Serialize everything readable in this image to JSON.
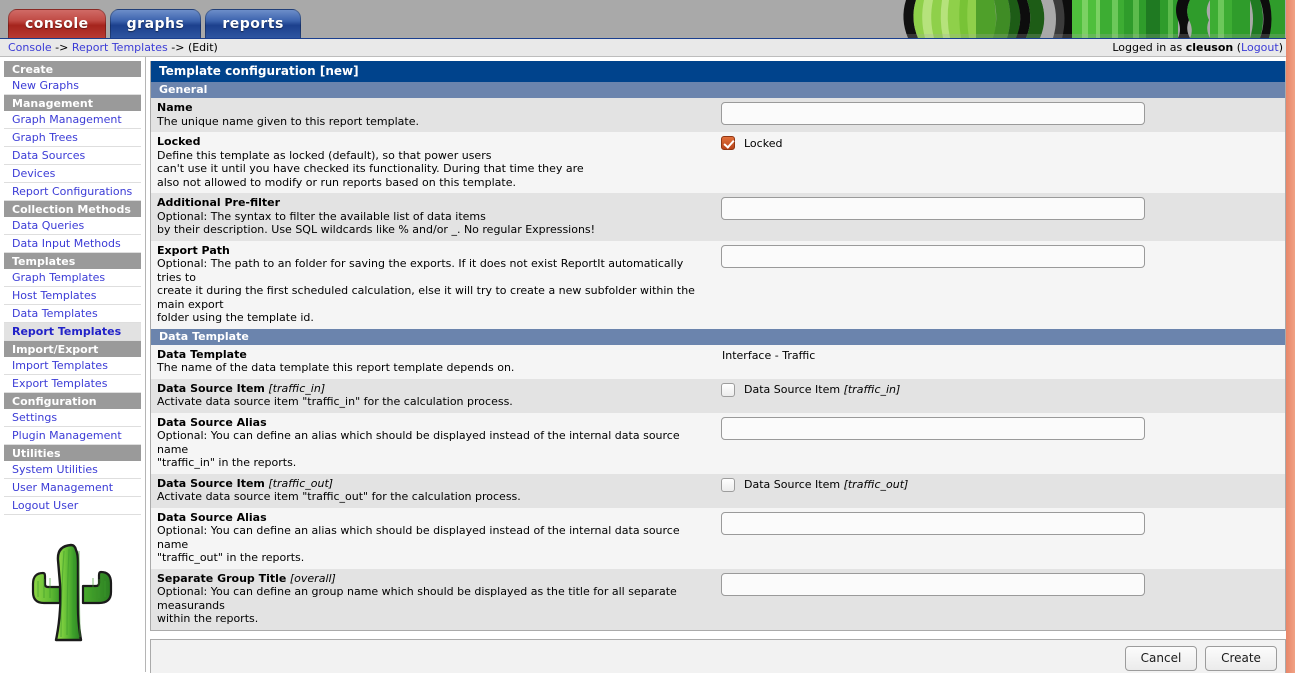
{
  "app": {
    "tabs": [
      {
        "label": "console",
        "style": "red"
      },
      {
        "label": "graphs",
        "style": "blue"
      },
      {
        "label": "reports",
        "style": "blue"
      }
    ],
    "breadcrumb": "Console -> Report Templates -> (Edit)",
    "breadcrumb_parts": {
      "console": "Console",
      "sep1": " -> ",
      "report_templates": "Report Templates",
      "sep2": " -> ",
      "current": "(Edit)"
    },
    "login": {
      "prefix": "Logged in as ",
      "user": "cleuson",
      "logout_open": " (",
      "logout": "Logout",
      "logout_close": ")"
    }
  },
  "colors": {
    "title_bar": "#00438C",
    "section_bar": "#6B84AD",
    "nav_header": "#9A9A9A",
    "link": "#3B3BD6",
    "checkbox_checked": "#C8561F",
    "edge_strip": "#EF9578",
    "tab_red": "#A5241D",
    "tab_blue": "#1C408D"
  },
  "sidebar": {
    "groups": [
      {
        "header": "Create",
        "items": [
          {
            "label": "New Graphs",
            "selected": false
          }
        ]
      },
      {
        "header": "Management",
        "items": [
          {
            "label": "Graph Management",
            "selected": false
          },
          {
            "label": "Graph Trees",
            "selected": false
          },
          {
            "label": "Data Sources",
            "selected": false
          },
          {
            "label": "Devices",
            "selected": false
          },
          {
            "label": "Report Configurations",
            "selected": false
          }
        ]
      },
      {
        "header": "Collection Methods",
        "items": [
          {
            "label": "Data Queries",
            "selected": false
          },
          {
            "label": "Data Input Methods",
            "selected": false
          }
        ]
      },
      {
        "header": "Templates",
        "items": [
          {
            "label": "Graph Templates",
            "selected": false
          },
          {
            "label": "Host Templates",
            "selected": false
          },
          {
            "label": "Data Templates",
            "selected": false
          },
          {
            "label": "Report Templates",
            "selected": true
          }
        ]
      },
      {
        "header": "Import/Export",
        "items": [
          {
            "label": "Import Templates",
            "selected": false
          },
          {
            "label": "Export Templates",
            "selected": false
          }
        ]
      },
      {
        "header": "Configuration",
        "items": [
          {
            "label": "Settings",
            "selected": false
          },
          {
            "label": "Plugin Management",
            "selected": false
          }
        ]
      },
      {
        "header": "Utilities",
        "items": [
          {
            "label": "System Utilities",
            "selected": false
          },
          {
            "label": "User Management",
            "selected": false
          },
          {
            "label": "Logout User",
            "selected": false
          }
        ]
      }
    ],
    "logo_icon": "cactus-icon"
  },
  "form": {
    "title": "Template configuration [new]",
    "sections": [
      {
        "header": "General",
        "rows": [
          {
            "label": "Name",
            "label_suffix": "",
            "desc": "The unique name given to this report template.",
            "control": "text",
            "value": "",
            "placeholder": "",
            "shade": "alt"
          },
          {
            "label": "Locked",
            "label_suffix": "",
            "desc": "Define this template as locked (default), so that power users\ncan't use it until you have checked its functionality. During that time they are\nalso not allowed to modify or run reports based on this template.",
            "control": "checkbox",
            "checked": true,
            "checkbox_label": "Locked",
            "checkbox_label_suffix": "",
            "shade": "main"
          },
          {
            "label": "Additional Pre-filter",
            "label_suffix": "",
            "desc": "Optional: The syntax to filter the available list of data items\nby their description. Use SQL wildcards like % and/or _. No regular Expressions!",
            "control": "text",
            "value": "",
            "placeholder": "",
            "shade": "alt"
          },
          {
            "label": "Export Path",
            "label_suffix": "",
            "desc": "Optional: The path to an folder for saving the exports. If it does not exist ReportIt automatically tries to\ncreate it during the first scheduled calculation, else it will try to create a new subfolder within the main export\nfolder using the template id.",
            "control": "text",
            "value": "",
            "placeholder": "",
            "shade": "main"
          }
        ]
      },
      {
        "header": "Data Template",
        "rows": [
          {
            "label": "Data Template",
            "label_suffix": "",
            "desc": "The name of the data template this report template depends on.",
            "control": "static",
            "value": "Interface - Traffic",
            "shade": "main"
          },
          {
            "label": "Data Source Item",
            "label_suffix": " [traffic_in]",
            "desc": "Activate data source item \"traffic_in\" for the calculation process.",
            "control": "checkbox",
            "checked": false,
            "checkbox_label": "Data Source Item ",
            "checkbox_label_suffix": "[traffic_in]",
            "shade": "alt"
          },
          {
            "label": "Data Source Alias",
            "label_suffix": "",
            "desc": "Optional: You can define an alias which should be displayed instead of the internal data source name\n\"traffic_in\" in the reports.",
            "control": "text",
            "value": "",
            "placeholder": "",
            "shade": "main"
          },
          {
            "label": "Data Source Item",
            "label_suffix": " [traffic_out]",
            "desc": "Activate data source item \"traffic_out\" for the calculation process.",
            "control": "checkbox",
            "checked": false,
            "checkbox_label": "Data Source Item ",
            "checkbox_label_suffix": "[traffic_out]",
            "shade": "alt"
          },
          {
            "label": "Data Source Alias",
            "label_suffix": "",
            "desc": "Optional: You can define an alias which should be displayed instead of the internal data source name\n\"traffic_out\" in the reports.",
            "control": "text",
            "value": "",
            "placeholder": "",
            "shade": "main"
          },
          {
            "label": "Separate Group Title",
            "label_suffix": " [overall]",
            "desc": "Optional: You can define an group name which should be displayed as the title for all separate measurands\nwithin the reports.",
            "control": "text",
            "value": "",
            "placeholder": "",
            "shade": "alt"
          }
        ]
      }
    ],
    "buttons": [
      {
        "label": "Cancel",
        "name": "cancel-button"
      },
      {
        "label": "Create",
        "name": "create-button"
      }
    ]
  }
}
